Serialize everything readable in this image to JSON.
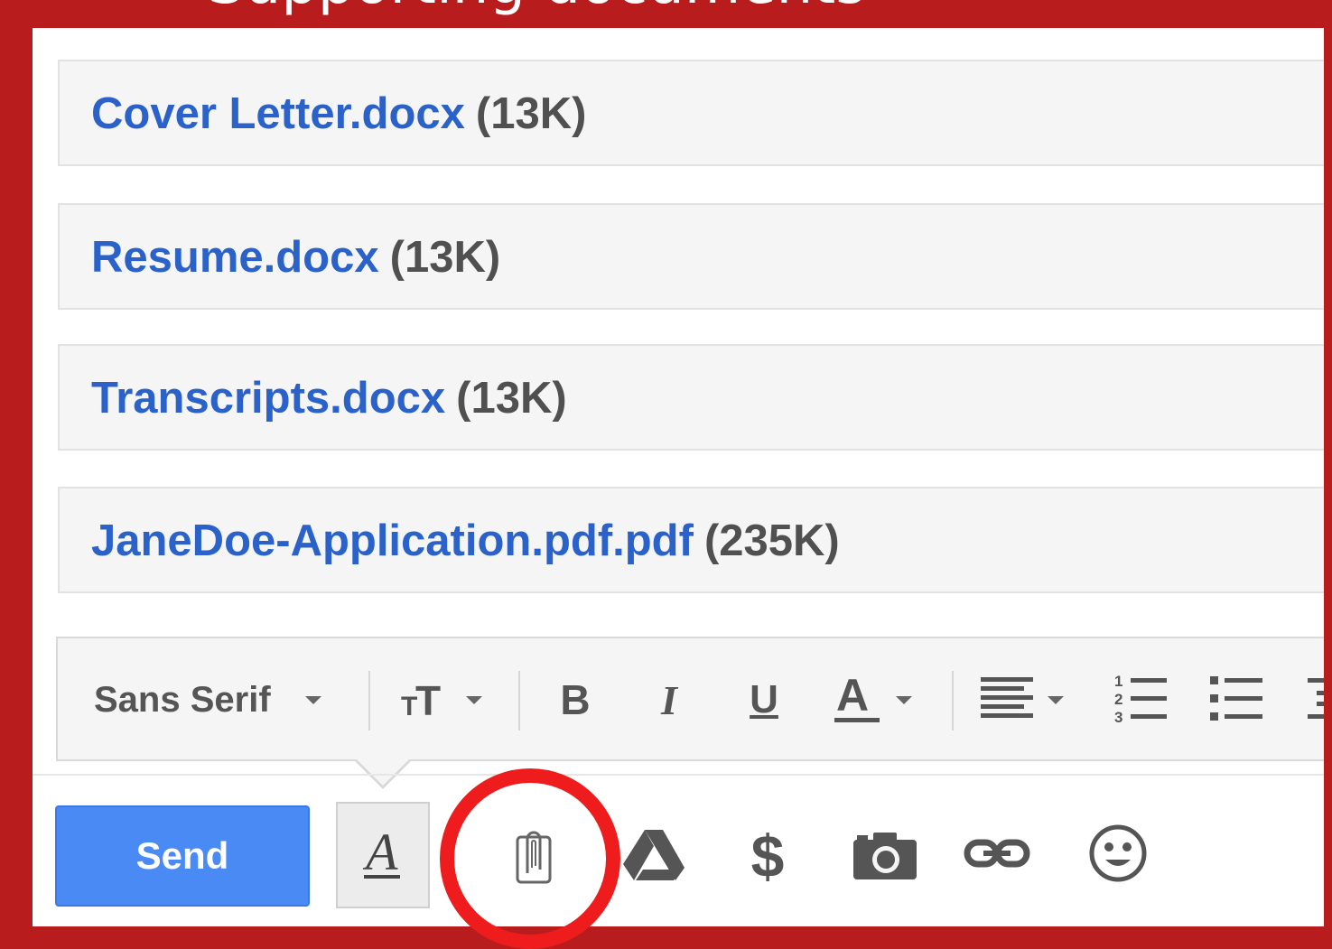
{
  "heading_partial": "Supporting documents",
  "attachments": [
    {
      "name": "Cover Letter.docx",
      "size": "(13K)"
    },
    {
      "name": "Resume.docx",
      "size": "(13K)"
    },
    {
      "name": "Transcripts.docx",
      "size": "(13K)"
    },
    {
      "name": "JaneDoe-Application.pdf.pdf",
      "size": "(235K)"
    }
  ],
  "formatting": {
    "font_family": "Sans Serif",
    "size_icon": "text-size-icon",
    "bold_icon": "bold-icon",
    "italic_icon": "italic-icon",
    "underline_icon": "underline-icon",
    "text_color_icon": "text-color-icon",
    "align_icon": "align-icon",
    "numbered_list_icon": "numbered-list-icon",
    "bulleted_list_icon": "bulleted-list-icon",
    "indent_icon": "indent-icon"
  },
  "toolbar": {
    "send_label": "Send",
    "format_toggle_icon": "formatting-options-icon",
    "attach_icon": "paperclip-icon",
    "drive_icon": "google-drive-icon",
    "money_icon": "dollar-icon",
    "photo_icon": "camera-icon",
    "link_icon": "link-icon",
    "emoji_icon": "smiley-icon"
  },
  "colors": {
    "frame": "#b81c1c",
    "highlight": "#ee1c1c",
    "link": "#2a62c9",
    "send": "#4a8af4"
  }
}
